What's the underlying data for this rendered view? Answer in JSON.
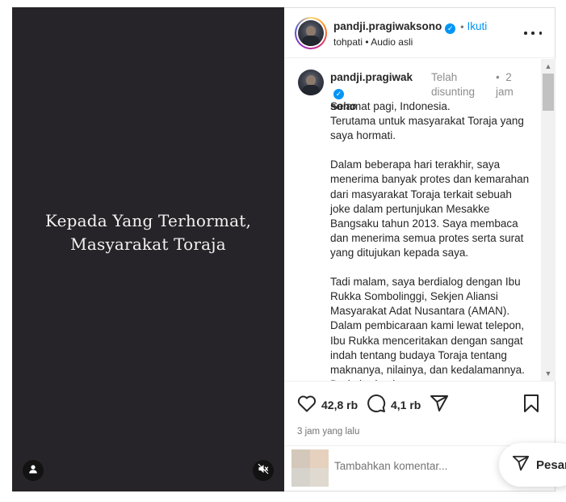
{
  "media": {
    "caption_line1": "Kepada Yang Terhormat,",
    "caption_line2": "Masyarakat Toraja",
    "user_tag_icon": "user-icon",
    "mute_icon": "speaker-muted-icon"
  },
  "header": {
    "username": "pandji.pragiwaksono",
    "verified": true,
    "separator": "•",
    "follow_label": "Ikuti",
    "audio_owner": "tohpati",
    "audio_separator": "•",
    "audio_label": "Audio asli",
    "more_icon": "more-horizontal-icon"
  },
  "caption": {
    "username_line1": "pandji.pragiwak",
    "username_line2": "sono",
    "edited_line1": "Telah",
    "edited_line2": "disunting",
    "separator": "•",
    "time_line1": "2",
    "time_line2": "jam",
    "text": "Selamat pagi, Indonesia.\nTerutama untuk masyarakat Toraja yang saya hormati.\n\nDalam beberapa hari terakhir, saya menerima banyak protes dan kemarahan dari masyarakat Toraja terkait sebuah joke dalam pertunjukan Mesakke Bangsaku tahun 2013. Saya membaca dan menerima semua protes serta surat yang ditujukan kepada saya.\n\nTadi malam, saya berdialog dengan Ibu Rukka Sombolinggi, Sekjen Aliansi Masyarakat Adat Nusantara (AMAN). Dalam pembicaraan kami lewat telepon, Ibu Rukka menceritakan dengan sangat indah tentang budaya Toraja tentang maknanya, nilainya, dan kedalamannya. Dari obrolan itu, saya"
  },
  "actions": {
    "like_icon": "heart-icon",
    "like_count": "42,8 rb",
    "comment_icon": "comment-bubble-icon",
    "comment_count": "4,1 rb",
    "share_icon": "send-icon",
    "save_icon": "bookmark-icon",
    "time_ago": "3 jam yang lalu"
  },
  "comment_box": {
    "placeholder": "Tambahkan komentar..."
  },
  "messages": {
    "icon": "send-icon",
    "label": "Pesan"
  },
  "colors": {
    "media_bg": "#262428",
    "link_blue": "#0095f6",
    "verified_blue": "#0095f6",
    "text": "#262626",
    "muted": "#8e8e8e"
  }
}
